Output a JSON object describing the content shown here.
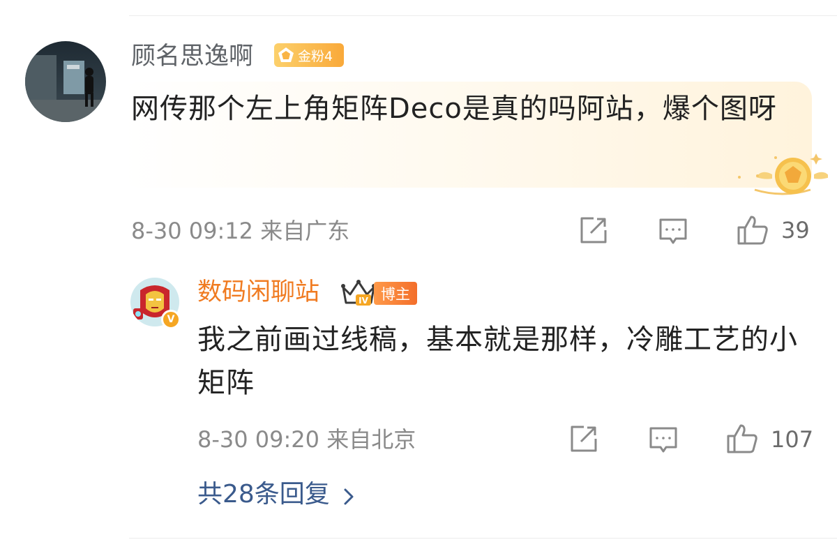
{
  "comment": {
    "username": "顾名思逸啊",
    "fan_badge": "金粉4",
    "text": "网传那个左上角矩阵Deco是真的吗阿站，爆个图呀",
    "meta": "8-30 09:12 来自广东",
    "likes": "39"
  },
  "reply": {
    "username": "数码闲聊站",
    "level_badge": "IV",
    "role_badge": "博主",
    "verify_mark": "V",
    "text": "我之前画过线稿，基本就是那样，冷雕工艺的小矩阵",
    "meta": "8-30 09:20 来自北京",
    "likes": "107"
  },
  "more_replies": "共28条回复",
  "colors": {
    "username_gray": "#5f6368",
    "username_orange": "#f07b21",
    "link_blue": "#3a5a8c",
    "meta_gray": "#8a8a8a",
    "badge_gold": "#f9a93a"
  },
  "icons": [
    "share-icon",
    "comment-icon",
    "like-icon",
    "chevron-right-icon",
    "crown-icon",
    "gold-medal-icon"
  ]
}
